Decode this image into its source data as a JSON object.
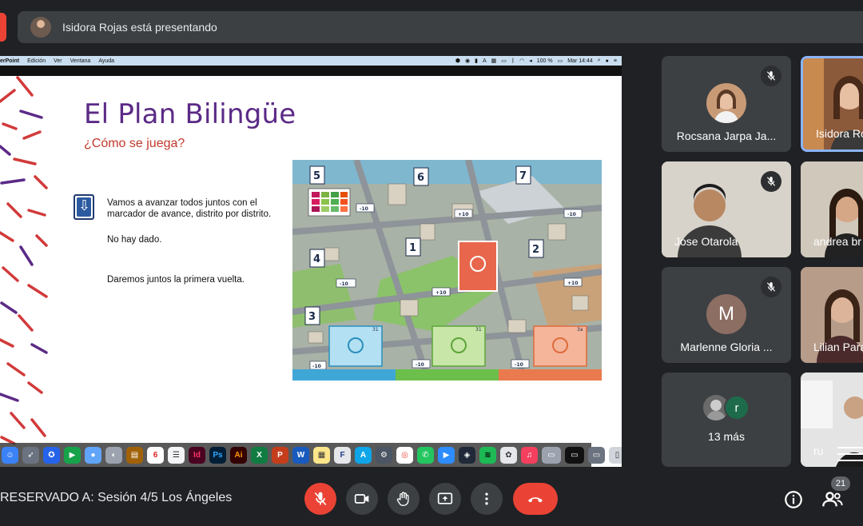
{
  "banner": {
    "text": "Isidora Rojas está presentando"
  },
  "mac_menubar": {
    "app": "erPoint",
    "menus": [
      "Edición",
      "Ver",
      "Ventana",
      "Ayuda"
    ],
    "battery": "100 %",
    "clock": "Mar 14:44"
  },
  "slide": {
    "title": "El Plan Bilingüe",
    "subtitle": "¿Cómo se juega?",
    "paragraphs": [
      "Vamos a avanzar todos juntos con el marcador de avance, distrito por distrito.",
      "No hay dado.",
      "Daremos juntos la primera vuelta."
    ]
  },
  "board": {
    "district_numbers": [
      "5",
      "6",
      "7",
      "4",
      "1",
      "2",
      "3"
    ],
    "bonus_labels": [
      "-10",
      "+10",
      "-10",
      "-10",
      "+10",
      "+10",
      "-10",
      "-10",
      "-10"
    ],
    "card_numbers": [
      "31",
      "31",
      "3a"
    ]
  },
  "dock": {
    "calendar_day": "6"
  },
  "participants": [
    {
      "name": "Rocsana Jarpa Ja...",
      "muted": true
    },
    {
      "name": "Isidora Ro",
      "muted": false,
      "active": true
    },
    {
      "name": "Jose Otarola",
      "muted": true
    },
    {
      "name": "andrea br",
      "muted": false
    },
    {
      "name": "Marlenne Gloria ...",
      "initial": "M",
      "muted": true
    },
    {
      "name": "Lilian Para",
      "muted": false
    },
    {
      "name": "13 más",
      "initial": "r"
    },
    {
      "name": "ru"
    }
  ],
  "meeting": {
    "title": "RESERVADO A: Sesión 4/5 Los Ángeles",
    "participant_count": "21"
  },
  "colors": {
    "accent": "#8ab4f8",
    "danger": "#ea4335",
    "tile": "#3c4043",
    "title_purple": "#5b2a86",
    "subtitle_red": "#c0392b"
  }
}
